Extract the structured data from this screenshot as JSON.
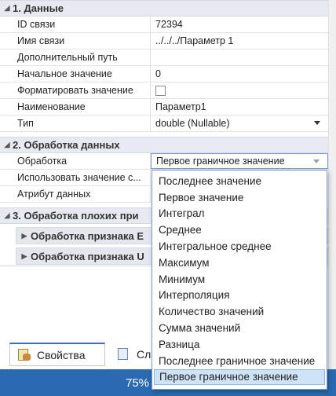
{
  "section1": {
    "title": "1. Данные",
    "rows": [
      {
        "name": "ID связи",
        "value": "72394"
      },
      {
        "name": "Имя связи",
        "value": "../../../Параметр 1"
      },
      {
        "name": "Дополнительный путь",
        "value": ""
      },
      {
        "name": "Начальное значение",
        "value": "0"
      },
      {
        "name": "Форматировать значение",
        "value": "",
        "checkbox": true,
        "checked": false
      },
      {
        "name": "Наименование",
        "value": "Параметр1"
      },
      {
        "name": "Тип",
        "value": "double (Nullable)",
        "dropdown": true
      }
    ]
  },
  "section2": {
    "title": "2. Обработка данных",
    "rows": [
      {
        "name": "Обработка",
        "value": "Первое граничное значение"
      },
      {
        "name": "Использовать значение с...",
        "value": ""
      },
      {
        "name": "Атрибут данных",
        "value": ""
      }
    ]
  },
  "section3": {
    "title": "3. Обработка плохих при",
    "subgroups": [
      {
        "title": "Обработка признака Е"
      },
      {
        "title": "Обработка признака U"
      }
    ]
  },
  "dropdown": {
    "options": [
      "Последнее значение",
      "Первое значение",
      "Интеграл",
      "Среднее",
      "Интегральное среднее",
      "Максимум",
      "Минимум",
      "Интерполяция",
      "Количество значений",
      "Сумма значений",
      "Разница",
      "Последнее граничное значение",
      "Первое граничное значение"
    ],
    "selected_index": 12
  },
  "tabs": {
    "properties": "Свойства",
    "second": "Сл"
  },
  "status": {
    "zoom": "75%"
  },
  "colors": {
    "accent": "#2a6ab0",
    "category_bg": "#e7eaf0",
    "selection": "#cfe3f7"
  }
}
